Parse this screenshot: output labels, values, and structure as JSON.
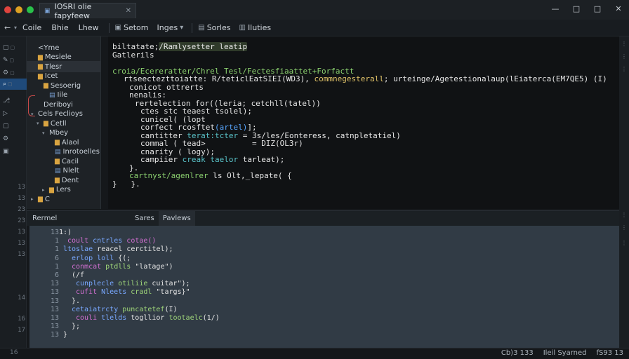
{
  "window": {
    "traffic_colors": [
      "#e0443e",
      "#dea123",
      "#29c14a"
    ],
    "tab_title": "IOSRI olie fapyfeew",
    "controls": [
      "—",
      "□",
      "□",
      "✕"
    ]
  },
  "menubar": {
    "back_icon": "←",
    "menus": [
      "Coile",
      "Bhie",
      "Lhew"
    ],
    "tools": [
      {
        "icon": "▣",
        "label": "Setom"
      },
      {
        "icon": "",
        "label": "Inges"
      },
      {
        "icon": "▤",
        "label": "Sorles"
      },
      {
        "icon": "▥",
        "label": "Iluties"
      }
    ]
  },
  "activity_numbers": [
    "13",
    "13",
    "23",
    "23",
    "13",
    "13",
    "13",
    "14",
    "16",
    "17"
  ],
  "explorer": {
    "items": [
      {
        "indent": 0,
        "caret": "",
        "type": "none",
        "label": "<Yme"
      },
      {
        "indent": 0,
        "caret": "",
        "type": "folder",
        "label": "Mesiele"
      },
      {
        "indent": 0,
        "caret": "",
        "type": "folder",
        "label": "Tlesr",
        "selected": true
      },
      {
        "indent": 0,
        "caret": "",
        "type": "folder",
        "label": "Icet"
      },
      {
        "indent": 1,
        "caret": "",
        "type": "folder",
        "label": "Sesoerig"
      },
      {
        "indent": 2,
        "caret": "",
        "type": "file",
        "label": "Iile"
      },
      {
        "indent": 1,
        "caret": "",
        "type": "none",
        "label": "Deriboyi"
      },
      {
        "indent": 0,
        "caret": "▾",
        "type": "none",
        "label": "Cels Feclioys"
      },
      {
        "indent": 1,
        "caret": "▾",
        "type": "folder",
        "label": "Cetll"
      },
      {
        "indent": 2,
        "caret": "▾",
        "type": "none",
        "label": "Mbey"
      },
      {
        "indent": 3,
        "caret": "",
        "type": "folder",
        "label": "Alaol"
      },
      {
        "indent": 3,
        "caret": "",
        "type": "file",
        "label": "Inrotoelles"
      },
      {
        "indent": 3,
        "caret": "",
        "type": "folder",
        "label": "Cacil"
      },
      {
        "indent": 3,
        "caret": "",
        "type": "file",
        "label": "Nlelt"
      },
      {
        "indent": 3,
        "caret": "",
        "type": "folder",
        "label": "Dent"
      },
      {
        "indent": 2,
        "caret": "▸",
        "type": "folder",
        "label": "Lers"
      },
      {
        "indent": 0,
        "caret": "▸",
        "type": "folder",
        "label": "C"
      }
    ]
  },
  "editor": {
    "lines": [
      {
        "indent": 0,
        "parts": [
          {
            "t": "biltatate;",
            "c": "white"
          },
          {
            "t": "/Ramlysetter leatip",
            "c": "hl"
          }
        ]
      },
      {
        "indent": 0,
        "parts": [
          {
            "t": "Gatlerils",
            "c": "white"
          }
        ]
      },
      {
        "indent": 0,
        "parts": []
      },
      {
        "indent": 0,
        "parts": [
          {
            "t": "croia/Ecereratter/Chrel Tesl/Fectesfiaattet+Forfactt",
            "c": "green"
          }
        ]
      },
      {
        "indent": 2,
        "parts": [
          {
            "t": "rtseectezttoiatte: R/teticlEatSIEI(WD3), ",
            "c": "white"
          },
          {
            "t": "commnegesterall",
            "c": "yellow"
          },
          {
            "t": "; urteinge/Agetestionalaup(lEiaterca(EM7QE5) (I)",
            "c": "white"
          }
        ]
      },
      {
        "indent": 3,
        "parts": [
          {
            "t": "conicot ottrerts",
            "c": "white"
          }
        ]
      },
      {
        "indent": 3,
        "parts": [
          {
            "t": "nenalis:",
            "c": "white"
          }
        ]
      },
      {
        "indent": 4,
        "parts": [
          {
            "t": "rertelection for((leria; cetchll(tatel))",
            "c": "white"
          }
        ]
      },
      {
        "indent": 5,
        "parts": [
          {
            "t": "ctes stc teaest tsolel);",
            "c": "white"
          }
        ]
      },
      {
        "indent": 5,
        "parts": [
          {
            "t": "cunicel( (lopt",
            "c": "white"
          }
        ]
      },
      {
        "indent": 5,
        "parts": [
          {
            "t": "corfect rcosftet",
            "c": "white"
          },
          {
            "t": "(artel)",
            "c": "blue"
          },
          {
            "t": "];",
            "c": "white"
          }
        ]
      },
      {
        "indent": 5,
        "parts": [
          {
            "t": "cantitter ",
            "c": "white"
          },
          {
            "t": "terat:tcter",
            "c": "cyan"
          },
          {
            "t": " = 3s/les/Eonteress, catnpletatiel)",
            "c": "white"
          }
        ]
      },
      {
        "indent": 5,
        "parts": [
          {
            "t": "commal ( tead>          = ",
            "c": "white"
          },
          {
            "t": "DIZ(OL3r)",
            "c": "white"
          }
        ]
      },
      {
        "indent": 5,
        "parts": [
          {
            "t": "cnarity ( ",
            "c": "white"
          },
          {
            "t": "logy",
            "c": "white"
          },
          {
            "t": ");",
            "c": "white"
          }
        ]
      },
      {
        "indent": 5,
        "parts": [
          {
            "t": "campiier ",
            "c": "white"
          },
          {
            "t": "creak taelor",
            "c": "cyan"
          },
          {
            "t": " tarleat);",
            "c": "white"
          }
        ]
      },
      {
        "indent": 3,
        "parts": [
          {
            "t": "}.",
            "c": "white"
          }
        ]
      },
      {
        "indent": 3,
        "parts": [
          {
            "t": "cartnyst/agenlrer ",
            "c": "green"
          },
          {
            "t": "ls Olt,_lepate( {",
            "c": "white"
          }
        ]
      },
      {
        "indent": 0,
        "parts": [
          {
            "t": "}   }.",
            "c": "white"
          }
        ]
      }
    ]
  },
  "panel": {
    "title": "Rermel",
    "tabs": [
      "Sares",
      "Pavlews"
    ],
    "active_tab": 1,
    "line_numbers": [
      "13",
      "1",
      "1",
      "6",
      "1",
      "6",
      "13",
      "13",
      "13",
      "13",
      "13",
      "13",
      "13"
    ],
    "lines": [
      {
        "indent": 1,
        "parts": [
          {
            "t": "1:)",
            "c": "wht"
          }
        ]
      },
      {
        "indent": 3,
        "parts": [
          {
            "t": "coult ",
            "c": "mag"
          },
          {
            "t": "cntrles ",
            "c": "blu"
          },
          {
            "t": "cotae()",
            "c": "mag"
          }
        ]
      },
      {
        "indent": 2,
        "parts": [
          {
            "t": "ltoslae ",
            "c": "blu"
          },
          {
            "t": "reacel cerctitel);",
            "c": "wht"
          }
        ]
      },
      {
        "indent": 4,
        "parts": [
          {
            "t": "erlop loll",
            "c": "blu"
          },
          {
            "t": " {(;",
            "c": "wht"
          }
        ]
      },
      {
        "indent": 4,
        "parts": [
          {
            "t": "conmcat ",
            "c": "mag"
          },
          {
            "t": "ptdlls ",
            "c": "grn"
          },
          {
            "t": "\"latage\")",
            "c": "wht"
          }
        ]
      },
      {
        "indent": 4,
        "parts": [
          {
            "t": "(/f",
            "c": "wht"
          }
        ]
      },
      {
        "indent": 5,
        "parts": [
          {
            "t": "cunplecle ",
            "c": "blu"
          },
          {
            "t": "otiliie ",
            "c": "grn"
          },
          {
            "t": "cuitar\");",
            "c": "wht"
          }
        ]
      },
      {
        "indent": 5,
        "parts": [
          {
            "t": "cufit ",
            "c": "mag"
          },
          {
            "t": "Nleets ",
            "c": "blu"
          },
          {
            "t": "cradl ",
            "c": "grn"
          },
          {
            "t": "\"targs}\"",
            "c": "wht"
          }
        ]
      },
      {
        "indent": 4,
        "parts": [
          {
            "t": "}.",
            "c": "wht"
          }
        ]
      },
      {
        "indent": 4,
        "parts": [
          {
            "t": "cetaiatrcty ",
            "c": "blu"
          },
          {
            "t": "puncatetef",
            "c": "grn"
          },
          {
            "t": "(I)",
            "c": "wht"
          }
        ]
      },
      {
        "indent": 5,
        "parts": [
          {
            "t": "couli ",
            "c": "mag"
          },
          {
            "t": "tlelds ",
            "c": "blu"
          },
          {
            "t": "togllior ",
            "c": "wht"
          },
          {
            "t": "tootaelc",
            "c": "grn"
          },
          {
            "t": "(1/)",
            "c": "wht"
          }
        ]
      },
      {
        "indent": 4,
        "parts": [
          {
            "t": "};",
            "c": "wht"
          }
        ]
      },
      {
        "indent": 2,
        "parts": [
          {
            "t": "}",
            "c": "wht"
          }
        ]
      }
    ]
  },
  "status": {
    "left": "16",
    "right": [
      "Cb)3 133",
      "Ileil Syarned",
      "fS93 13"
    ]
  }
}
